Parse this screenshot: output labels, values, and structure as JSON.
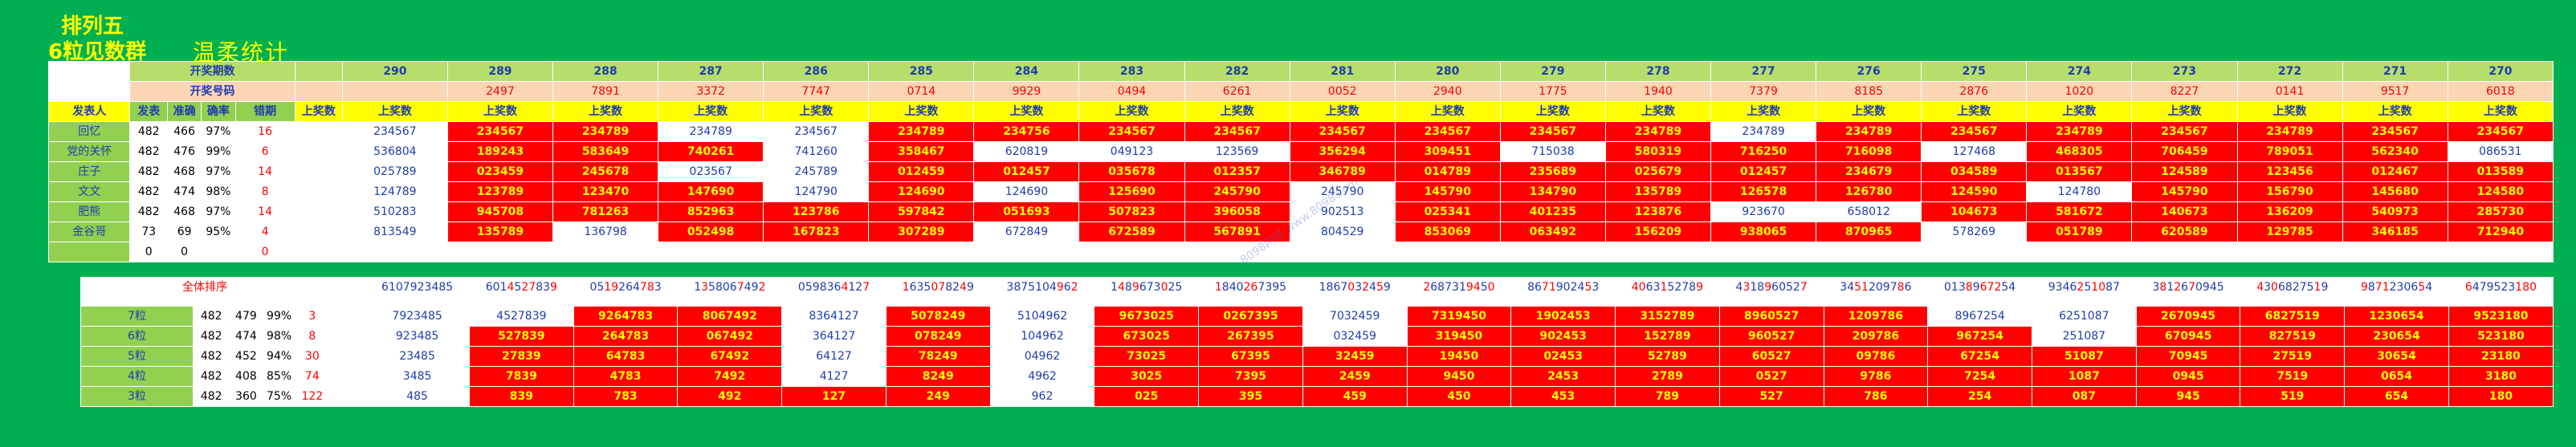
{
  "titles": {
    "line1": "排列五",
    "line2": "6粒见数群",
    "line3": "温柔统计"
  },
  "labels": {
    "period": "开奖期数",
    "code": "开奖号码",
    "poster": "发表人",
    "col_post": "发表",
    "col_hit": "准确",
    "col_rate": "确率",
    "col_miss": "错期",
    "prev": "上奖数",
    "overall": "全体排序"
  },
  "periods": [
    "290",
    "289",
    "288",
    "287",
    "286",
    "285",
    "284",
    "283",
    "282",
    "281",
    "280",
    "279",
    "278",
    "277",
    "276",
    "275",
    "274",
    "273",
    "272",
    "271",
    "270"
  ],
  "codes": [
    "2497",
    "7891",
    "3372",
    "7747",
    "0714",
    "9929",
    "0494",
    "6261",
    "0052",
    "2940",
    "1775",
    "1940",
    "7379",
    "8185",
    "2876",
    "1020",
    "8227",
    "0141",
    "9517",
    "6018"
  ],
  "posters": [
    {
      "name": "回忆",
      "post": "482",
      "hit": "466",
      "rate": "97%",
      "miss": "16",
      "values": [
        "",
        "234567",
        "234567",
        "234789",
        "234789",
        "234567",
        "234789",
        "234756",
        "234567",
        "234567",
        "234567",
        "234567",
        "234567",
        "234789",
        "234789",
        "234789",
        "234567",
        "234789",
        "234567",
        "234789",
        "234567",
        "234567"
      ]
    },
    {
      "name": "党的关怀",
      "post": "482",
      "hit": "476",
      "rate": "99%",
      "miss": "6",
      "values": [
        "",
        "536804",
        "189243",
        "583649",
        "740261",
        "741260",
        "358467",
        "620819",
        "049123",
        "123569",
        "356294",
        "309451",
        "715038",
        "580319",
        "716250",
        "716098",
        "127468",
        "468305",
        "706459",
        "789051",
        "562340",
        "086531"
      ]
    },
    {
      "name": "庄子",
      "post": "482",
      "hit": "468",
      "rate": "97%",
      "miss": "14",
      "values": [
        "",
        "025789",
        "023459",
        "245678",
        "023567",
        "245789",
        "012459",
        "012457",
        "035678",
        "012357",
        "346789",
        "014789",
        "235689",
        "025679",
        "012457",
        "234679",
        "034589",
        "013567",
        "124589",
        "123456",
        "012467",
        "013589"
      ]
    },
    {
      "name": "文文",
      "post": "482",
      "hit": "474",
      "rate": "98%",
      "miss": "8",
      "values": [
        "",
        "124789",
        "123789",
        "123470",
        "147690",
        "124790",
        "124690",
        "124690",
        "125690",
        "245790",
        "245790",
        "145790",
        "134790",
        "135789",
        "126578",
        "126780",
        "124590",
        "124780",
        "145790",
        "156790",
        "145680",
        "124580"
      ]
    },
    {
      "name": "肥熊",
      "post": "482",
      "hit": "468",
      "rate": "97%",
      "miss": "14",
      "values": [
        "",
        "510283",
        "945708",
        "781263",
        "852963",
        "123786",
        "597842",
        "051693",
        "507823",
        "396058",
        "902513",
        "025341",
        "401235",
        "123876",
        "923670",
        "658012",
        "104673",
        "581672",
        "140673",
        "136209",
        "540973",
        "285730"
      ]
    },
    {
      "name": "金谷哥",
      "post": "73",
      "hit": "69",
      "rate": "95%",
      "miss": "4",
      "values": [
        "",
        "813549",
        "135789",
        "136798",
        "052498",
        "167823",
        "307289",
        "672849",
        "672589",
        "567891",
        "804529",
        "853069",
        "063492",
        "156209",
        "938065",
        "870965",
        "578269",
        "051789",
        "620589",
        "129785",
        "346185",
        "712940"
      ]
    },
    {
      "name": "",
      "post": "0",
      "hit": "0",
      "rate": "",
      "miss": "0",
      "values": [
        "",
        "",
        "",
        "",
        "",
        "",
        "",
        "",
        "",
        "",
        "",
        "",
        "",
        "",
        "",
        "",
        "",
        "",
        "",
        "",
        "",
        ""
      ]
    }
  ],
  "overall_values": [
    "6107923485",
    "6014527839",
    "0519264783",
    "1358067492",
    "0598364127",
    "1635078249",
    "3875104962",
    "1489673025",
    "1840267395",
    "1867032459",
    "2687319450",
    "8671902453",
    "4063152789",
    "4318960527",
    "3451209786",
    "0138967254",
    "9346251087",
    "3812670945",
    "4306827519",
    "9871230654",
    "6479523180"
  ],
  "groups": [
    {
      "name": "7粒",
      "post": "482",
      "hit": "479",
      "rate": "99%",
      "miss": "3",
      "values": [
        "7923485",
        "4527839",
        "9264783",
        "8067492",
        "8364127",
        "5078249",
        "5104962",
        "9673025",
        "0267395",
        "7032459",
        "7319450",
        "1902453",
        "3152789",
        "8960527",
        "1209786",
        "8967254",
        "6251087",
        "2670945",
        "6827519",
        "1230654",
        "9523180"
      ]
    },
    {
      "name": "6粒",
      "post": "482",
      "hit": "474",
      "rate": "98%",
      "miss": "8",
      "values": [
        "923485",
        "527839",
        "264783",
        "067492",
        "364127",
        "078249",
        "104962",
        "673025",
        "267395",
        "032459",
        "319450",
        "902453",
        "152789",
        "960527",
        "209786",
        "967254",
        "251087",
        "670945",
        "827519",
        "230654",
        "523180"
      ]
    },
    {
      "name": "5粒",
      "post": "482",
      "hit": "452",
      "rate": "94%",
      "miss": "30",
      "values": [
        "23485",
        "27839",
        "64783",
        "67492",
        "64127",
        "78249",
        "04962",
        "73025",
        "67395",
        "32459",
        "19450",
        "02453",
        "52789",
        "60527",
        "09786",
        "67254",
        "51087",
        "70945",
        "27519",
        "30654",
        "23180"
      ]
    },
    {
      "name": "4粒",
      "post": "482",
      "hit": "408",
      "rate": "85%",
      "miss": "74",
      "values": [
        "3485",
        "7839",
        "4783",
        "7492",
        "4127",
        "8249",
        "4962",
        "3025",
        "7395",
        "2459",
        "9450",
        "2453",
        "2789",
        "0527",
        "9786",
        "7254",
        "1087",
        "0945",
        "7519",
        "0654",
        "3180"
      ]
    },
    {
      "name": "3粒",
      "post": "482",
      "hit": "360",
      "rate": "75%",
      "miss": "122",
      "values": [
        "485",
        "839",
        "783",
        "492",
        "127",
        "249",
        "962",
        "025",
        "395",
        "459",
        "450",
        "453",
        "789",
        "527",
        "786",
        "254",
        "087",
        "945",
        "519",
        "654",
        "180"
      ]
    }
  ],
  "watermark": "8098网络 www.8098.com",
  "colors": {
    "background": "#00b050",
    "hit": "#ff0000",
    "title": "#ffff00",
    "text": "#1f3dab"
  }
}
